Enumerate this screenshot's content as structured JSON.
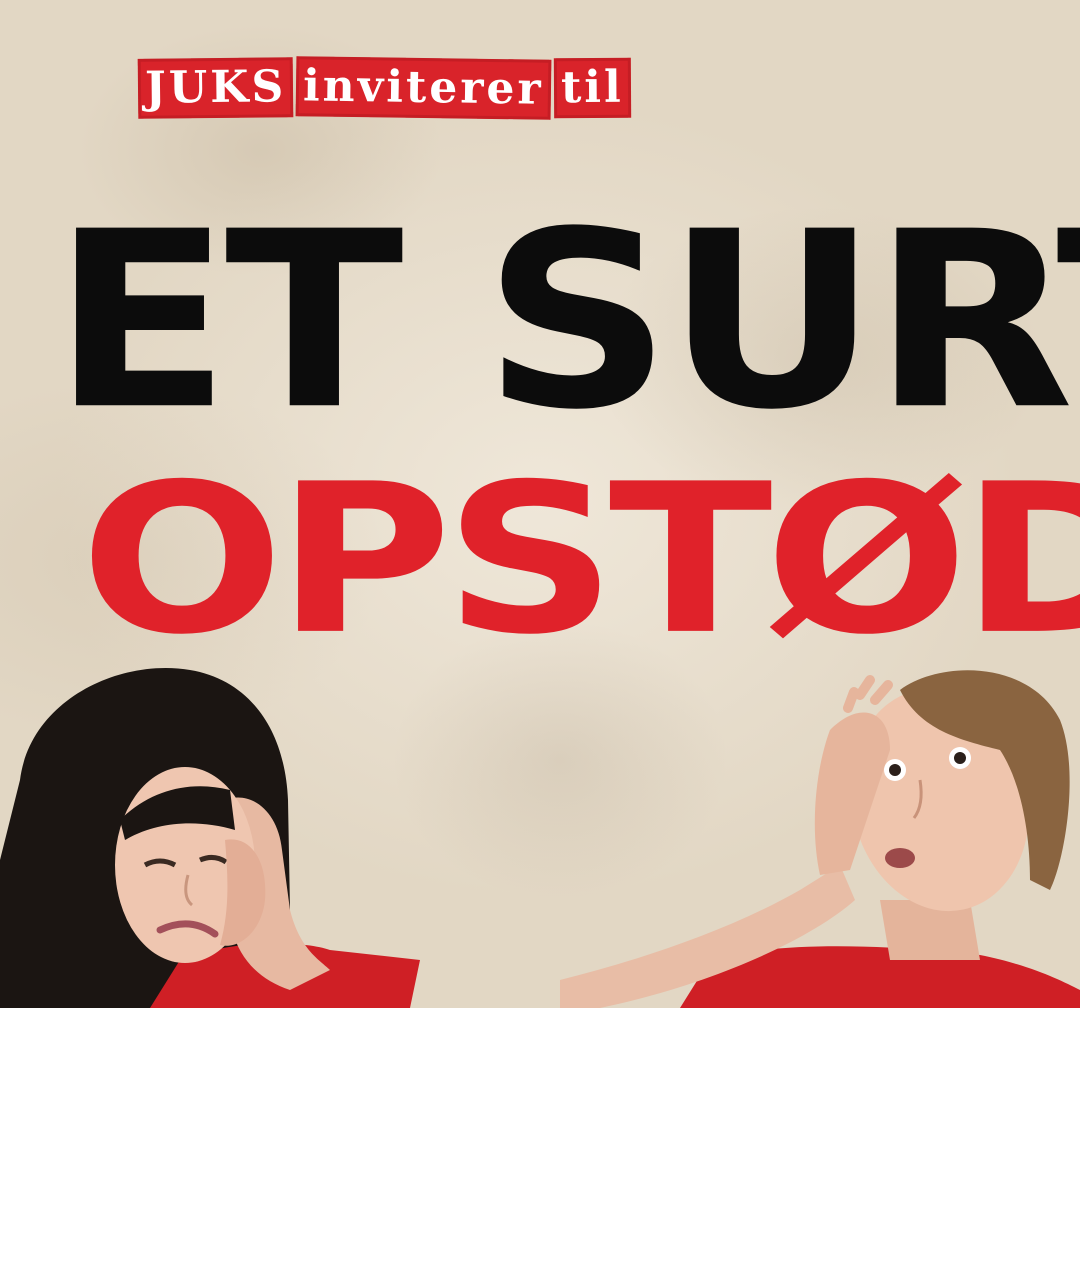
{
  "tagline": {
    "word_1": "JUKS",
    "word_2": "inviterer",
    "word_3": "til"
  },
  "headline": {
    "line_1": "ET SURT",
    "line_2": "OPSTØD"
  },
  "colors": {
    "accent_red": "#e0222a",
    "headline_black": "#0c0c0c",
    "paper_background": "#e9e0d0"
  },
  "photos": {
    "left": "woman-with-long-dark-hair-grimacing-icon",
    "right": "woman-with-short-hair-surprised-icon"
  }
}
